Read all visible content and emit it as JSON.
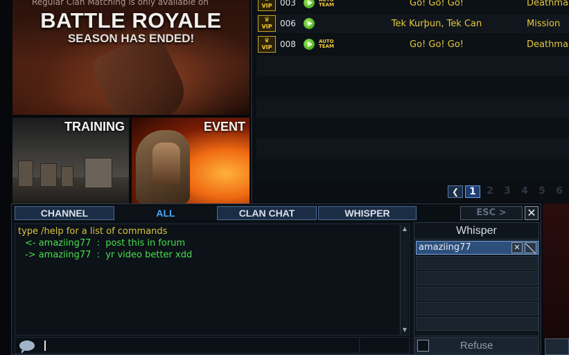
{
  "banners": {
    "battle_royale": {
      "top_text": "Regular Clan Matching is only available on",
      "title": "BATTLE ROYALE",
      "subtitle": "SEASON HAS ENDED!"
    },
    "training": {
      "label": "TRAINING"
    },
    "event": {
      "label": "EVENT"
    }
  },
  "rooms": [
    {
      "number": "003",
      "vip": "VIP",
      "auto_team": true,
      "title": "Go! Go! Go!",
      "mode": "Deathma"
    },
    {
      "number": "006",
      "vip": "VIP",
      "auto_team": false,
      "title": "Tek Kurþun, Tek Can",
      "mode": "Mission"
    },
    {
      "number": "008",
      "vip": "VIP",
      "auto_team": true,
      "title": "Go! Go! Go!",
      "mode": "Deathma"
    }
  ],
  "auto_team_label": "AUTO\nTEAM",
  "pager": {
    "prev_symbol": "❮",
    "pages": [
      "1",
      "2",
      "3",
      "4",
      "5",
      "6"
    ],
    "current": "1"
  },
  "chat": {
    "tabs": [
      {
        "label": "CHANNEL",
        "active": false
      },
      {
        "label": "ALL",
        "active": true
      },
      {
        "label": "CLAN CHAT",
        "active": false
      },
      {
        "label": "WHISPER",
        "active": false
      }
    ],
    "esc_label": "ESC >",
    "close_symbol": "✕",
    "messages": [
      {
        "type": "system",
        "text": "type /help for a list of commands"
      },
      {
        "type": "incoming",
        "text": "<- amaziing77  :  post this in forum"
      },
      {
        "type": "outgoing",
        "text": "-> amaziing77  :  yr video better xdd"
      }
    ],
    "input_value": ""
  },
  "whisper": {
    "title": "Whisper",
    "contacts": [
      "amaziing77"
    ],
    "remove_symbol": "✕",
    "refuse_label": "Refuse",
    "refuse_checked": false
  },
  "colors": {
    "accent_blue": "#4aa8ff",
    "room_text": "#e8c93a",
    "chat_system": "#dcc43a",
    "chat_message": "#48e04a"
  }
}
